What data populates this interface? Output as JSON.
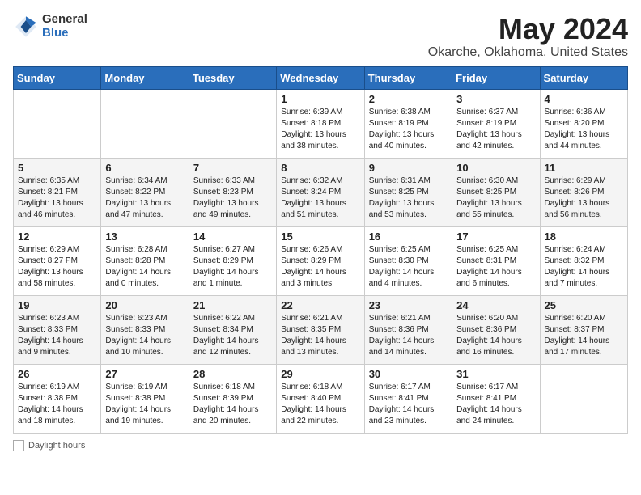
{
  "header": {
    "logo_general": "General",
    "logo_blue": "Blue",
    "month": "May 2024",
    "location": "Okarche, Oklahoma, United States"
  },
  "weekdays": [
    "Sunday",
    "Monday",
    "Tuesday",
    "Wednesday",
    "Thursday",
    "Friday",
    "Saturday"
  ],
  "weeks": [
    [
      {
        "day": "",
        "info": ""
      },
      {
        "day": "",
        "info": ""
      },
      {
        "day": "",
        "info": ""
      },
      {
        "day": "1",
        "info": "Sunrise: 6:39 AM\nSunset: 8:18 PM\nDaylight: 13 hours\nand 38 minutes."
      },
      {
        "day": "2",
        "info": "Sunrise: 6:38 AM\nSunset: 8:19 PM\nDaylight: 13 hours\nand 40 minutes."
      },
      {
        "day": "3",
        "info": "Sunrise: 6:37 AM\nSunset: 8:19 PM\nDaylight: 13 hours\nand 42 minutes."
      },
      {
        "day": "4",
        "info": "Sunrise: 6:36 AM\nSunset: 8:20 PM\nDaylight: 13 hours\nand 44 minutes."
      }
    ],
    [
      {
        "day": "5",
        "info": "Sunrise: 6:35 AM\nSunset: 8:21 PM\nDaylight: 13 hours\nand 46 minutes."
      },
      {
        "day": "6",
        "info": "Sunrise: 6:34 AM\nSunset: 8:22 PM\nDaylight: 13 hours\nand 47 minutes."
      },
      {
        "day": "7",
        "info": "Sunrise: 6:33 AM\nSunset: 8:23 PM\nDaylight: 13 hours\nand 49 minutes."
      },
      {
        "day": "8",
        "info": "Sunrise: 6:32 AM\nSunset: 8:24 PM\nDaylight: 13 hours\nand 51 minutes."
      },
      {
        "day": "9",
        "info": "Sunrise: 6:31 AM\nSunset: 8:25 PM\nDaylight: 13 hours\nand 53 minutes."
      },
      {
        "day": "10",
        "info": "Sunrise: 6:30 AM\nSunset: 8:25 PM\nDaylight: 13 hours\nand 55 minutes."
      },
      {
        "day": "11",
        "info": "Sunrise: 6:29 AM\nSunset: 8:26 PM\nDaylight: 13 hours\nand 56 minutes."
      }
    ],
    [
      {
        "day": "12",
        "info": "Sunrise: 6:29 AM\nSunset: 8:27 PM\nDaylight: 13 hours\nand 58 minutes."
      },
      {
        "day": "13",
        "info": "Sunrise: 6:28 AM\nSunset: 8:28 PM\nDaylight: 14 hours\nand 0 minutes."
      },
      {
        "day": "14",
        "info": "Sunrise: 6:27 AM\nSunset: 8:29 PM\nDaylight: 14 hours\nand 1 minute."
      },
      {
        "day": "15",
        "info": "Sunrise: 6:26 AM\nSunset: 8:29 PM\nDaylight: 14 hours\nand 3 minutes."
      },
      {
        "day": "16",
        "info": "Sunrise: 6:25 AM\nSunset: 8:30 PM\nDaylight: 14 hours\nand 4 minutes."
      },
      {
        "day": "17",
        "info": "Sunrise: 6:25 AM\nSunset: 8:31 PM\nDaylight: 14 hours\nand 6 minutes."
      },
      {
        "day": "18",
        "info": "Sunrise: 6:24 AM\nSunset: 8:32 PM\nDaylight: 14 hours\nand 7 minutes."
      }
    ],
    [
      {
        "day": "19",
        "info": "Sunrise: 6:23 AM\nSunset: 8:33 PM\nDaylight: 14 hours\nand 9 minutes."
      },
      {
        "day": "20",
        "info": "Sunrise: 6:23 AM\nSunset: 8:33 PM\nDaylight: 14 hours\nand 10 minutes."
      },
      {
        "day": "21",
        "info": "Sunrise: 6:22 AM\nSunset: 8:34 PM\nDaylight: 14 hours\nand 12 minutes."
      },
      {
        "day": "22",
        "info": "Sunrise: 6:21 AM\nSunset: 8:35 PM\nDaylight: 14 hours\nand 13 minutes."
      },
      {
        "day": "23",
        "info": "Sunrise: 6:21 AM\nSunset: 8:36 PM\nDaylight: 14 hours\nand 14 minutes."
      },
      {
        "day": "24",
        "info": "Sunrise: 6:20 AM\nSunset: 8:36 PM\nDaylight: 14 hours\nand 16 minutes."
      },
      {
        "day": "25",
        "info": "Sunrise: 6:20 AM\nSunset: 8:37 PM\nDaylight: 14 hours\nand 17 minutes."
      }
    ],
    [
      {
        "day": "26",
        "info": "Sunrise: 6:19 AM\nSunset: 8:38 PM\nDaylight: 14 hours\nand 18 minutes."
      },
      {
        "day": "27",
        "info": "Sunrise: 6:19 AM\nSunset: 8:38 PM\nDaylight: 14 hours\nand 19 minutes."
      },
      {
        "day": "28",
        "info": "Sunrise: 6:18 AM\nSunset: 8:39 PM\nDaylight: 14 hours\nand 20 minutes."
      },
      {
        "day": "29",
        "info": "Sunrise: 6:18 AM\nSunset: 8:40 PM\nDaylight: 14 hours\nand 22 minutes."
      },
      {
        "day": "30",
        "info": "Sunrise: 6:17 AM\nSunset: 8:41 PM\nDaylight: 14 hours\nand 23 minutes."
      },
      {
        "day": "31",
        "info": "Sunrise: 6:17 AM\nSunset: 8:41 PM\nDaylight: 14 hours\nand 24 minutes."
      },
      {
        "day": "",
        "info": ""
      }
    ]
  ],
  "footer": {
    "daylight_label": "Daylight hours"
  }
}
